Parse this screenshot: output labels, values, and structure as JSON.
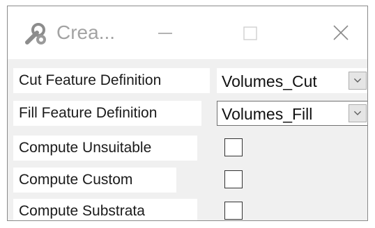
{
  "window": {
    "title": "Crea...",
    "icon": "wrench-gear-icon"
  },
  "title_buttons": {
    "minimize": "minimize-icon",
    "maximize": "maximize-icon",
    "close": "close-icon"
  },
  "fields": {
    "cut": {
      "label": "Cut Feature Definition",
      "value": "Volumes_Cut"
    },
    "fill": {
      "label": "Fill Feature Definition",
      "value": "Volumes_Fill"
    },
    "unsuitable": {
      "label": "Compute Unsuitable",
      "checked": false
    },
    "custom": {
      "label": "Compute Custom",
      "checked": false
    },
    "substrata": {
      "label": "Compute Substrata",
      "checked": false
    }
  },
  "colors": {
    "window_bg": "#f0f0f0",
    "title_text": "#a3a3a3",
    "field_bg": "#ffffff",
    "border": "#707070"
  }
}
